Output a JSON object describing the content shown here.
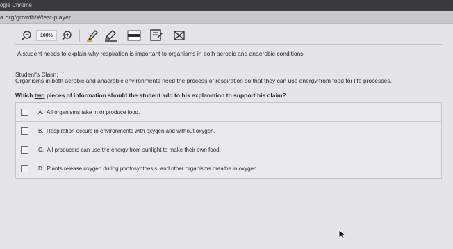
{
  "browser": {
    "title": "ogle Chrome",
    "url": "a.org/growth/#/test-player"
  },
  "toolbar": {
    "zoom_level": "100%",
    "icons": [
      "zoom-out-icon",
      "zoom-in-icon",
      "pencil-icon",
      "highlighter-icon",
      "line-reader-icon",
      "notepad-icon",
      "answer-eliminator-icon"
    ]
  },
  "question": {
    "stem": "A student needs to explain why respiration is important to organisms in both aerobic and anaerobic conditions.",
    "claim_label": "Student's Claim:",
    "claim_text": "Organisms in both aerobic and anaerobic environments need the process of respiration so that they can use energy from food for life processes.",
    "prompt_before": "Which ",
    "prompt_emphasis": "two",
    "prompt_after": " pieces of information should the student add to his explanation to support his claim?",
    "options": [
      {
        "letter": "A.",
        "text": "All organisms take in or produce food."
      },
      {
        "letter": "B.",
        "text": "Respiration occurs in environments with oxygen and without oxygen."
      },
      {
        "letter": "C.",
        "text": "All producers can use the energy from sunlight to make their own food."
      },
      {
        "letter": "D.",
        "text": "Plants release oxygen during photosynthesis, and other organisms breathe in oxygen."
      }
    ]
  }
}
